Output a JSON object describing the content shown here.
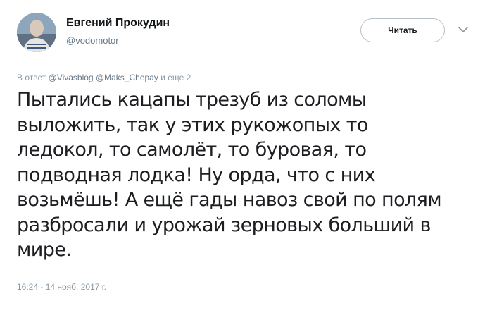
{
  "author": {
    "name": "Евгений Прокудин",
    "handle": "@vodomotor"
  },
  "follow_button": {
    "label": "Читать"
  },
  "reply_context": {
    "prefix": "В ответ",
    "mentions": [
      "@Vivasblog",
      "@Maks_Chepay"
    ],
    "suffix": "и еще 2"
  },
  "tweet": {
    "lines": [
      "Пытались кацапы трезуб из соломы",
      "выложить, так у этих рукожопых то",
      "ледокол, то самолёт, то буровая, то",
      "подводная лодка! Ну орда, что с них",
      "возьмёшь! А ещё гады навоз свой по полям",
      "разбросали и урожай зерновых больший в",
      "мире."
    ],
    "timestamp": "16:24 - 14 нояб. 2017 г."
  },
  "icons": {
    "menu": "chevron-down-icon",
    "avatar": "user-photo"
  },
  "colors": {
    "text": "#14171a",
    "secondary": "#657786",
    "muted": "#8899a6",
    "button_border": "#b8c0c8"
  }
}
